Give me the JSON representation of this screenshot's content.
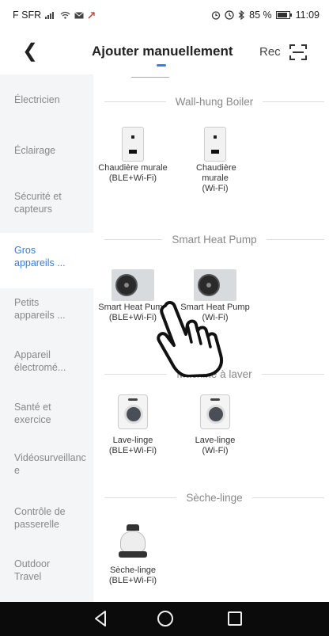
{
  "status": {
    "carrier": "F SFR",
    "battery": "85 %",
    "time": "11:09"
  },
  "header": {
    "title": "Ajouter manuellement",
    "rec_label": "Rec"
  },
  "sidebar": {
    "items": [
      {
        "label": "Électricien"
      },
      {
        "label": "Éclairage"
      },
      {
        "label": "Sécurité et capteurs"
      },
      {
        "label": "Gros appareils ..."
      },
      {
        "label": "Petits appareils ..."
      },
      {
        "label": "Appareil électromé..."
      },
      {
        "label": "Santé et exercice"
      },
      {
        "label": "Vidéosurveillance"
      },
      {
        "label": "Contrôle de passerelle"
      },
      {
        "label": "Outdoor Travel"
      }
    ]
  },
  "sections": [
    {
      "title": "Wall-hung Boiler",
      "devices": [
        {
          "label": "Chaudière murale (BLE+Wi-Fi)"
        },
        {
          "label": "Chaudière murale (Wi-Fi)"
        }
      ]
    },
    {
      "title": "Smart Heat Pump",
      "devices": [
        {
          "label": "Smart Heat Pump (BLE+Wi-Fi)"
        },
        {
          "label": "Smart Heat Pump (Wi-Fi)"
        }
      ]
    },
    {
      "title": "Machine à laver",
      "devices": [
        {
          "label": "Lave-linge (BLE+Wi-Fi)"
        },
        {
          "label": "Lave-linge (Wi-Fi)"
        }
      ]
    },
    {
      "title": "Sèche-linge",
      "devices": [
        {
          "label": "Sèche-linge (BLE+Wi-Fi)"
        }
      ]
    }
  ],
  "colors": {
    "accent": "#2d7ef7",
    "sidebar_bg": "#f4f5f7",
    "nav_bg": "#0b0b0b"
  }
}
